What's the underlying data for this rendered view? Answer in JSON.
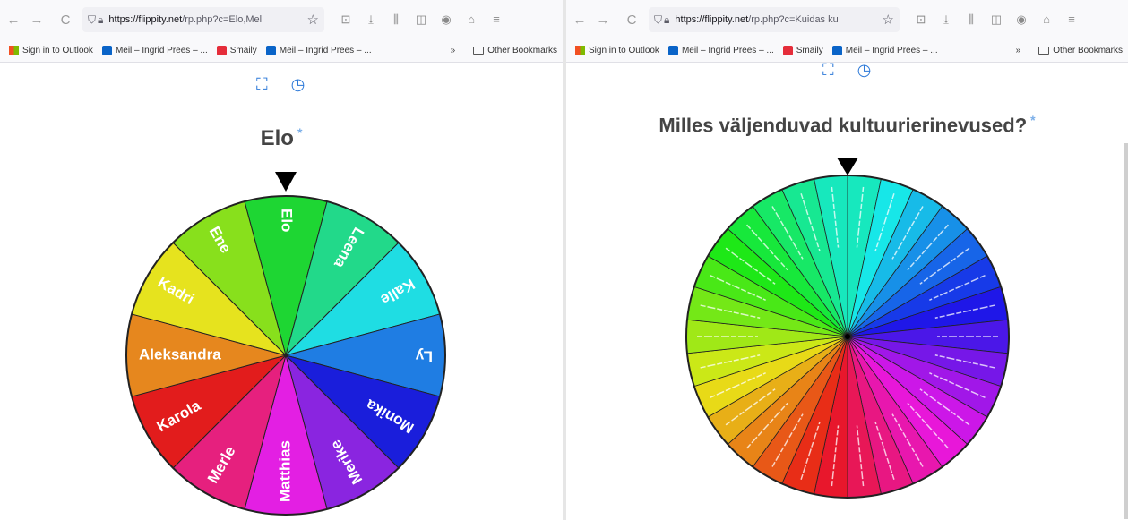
{
  "left": {
    "toolbar": {
      "url_host": "https://flippity.net",
      "url_path": "/rp.php?c=Elo,Mel"
    },
    "bookmarks": [
      {
        "label": "Sign in to Outlook",
        "icon": "microsoft-icon"
      },
      {
        "label": "Meil – Ingrid Prees – ...",
        "icon": "outlook-icon"
      },
      {
        "label": "Smaily",
        "icon": "smaily-icon"
      },
      {
        "label": "Meil – Ingrid Prees – ...",
        "icon": "outlook-icon"
      }
    ],
    "bookmarks_overflow": "»",
    "other_bookmarks": "Other Bookmarks",
    "title": "Elo",
    "title_link": "*",
    "wheel": [
      {
        "name": "Elo",
        "color": "#1ed633"
      },
      {
        "name": "Leena",
        "color": "#22d98a"
      },
      {
        "name": "Kalle",
        "color": "#1fdde3"
      },
      {
        "name": "Ly",
        "color": "#1f7de3"
      },
      {
        "name": "Monika",
        "color": "#1a1edb"
      },
      {
        "name": "Merike",
        "color": "#8a25e0"
      },
      {
        "name": "Matthias",
        "color": "#e31fe3"
      },
      {
        "name": "Merle",
        "color": "#e6207e"
      },
      {
        "name": "Karola",
        "color": "#e21c1c"
      },
      {
        "name": "Aleksandra",
        "color": "#e6871e"
      },
      {
        "name": "Kadri",
        "color": "#e6e31e"
      },
      {
        "name": "Ene",
        "color": "#88e01c"
      }
    ]
  },
  "right": {
    "toolbar": {
      "url_host": "https://flippity.net",
      "url_path": "/rp.php?c=Kuidas ku"
    },
    "bookmarks": [
      {
        "label": "Sign in to Outlook",
        "icon": "microsoft-icon"
      },
      {
        "label": "Meil – Ingrid Prees – ...",
        "icon": "outlook-icon"
      },
      {
        "label": "Smaily",
        "icon": "smaily-icon"
      },
      {
        "label": "Meil – Ingrid Prees – ...",
        "icon": "outlook-icon"
      }
    ],
    "bookmarks_overflow": "»",
    "other_bookmarks": "Other Bookmarks",
    "title": "Milles väljenduvad kultuurierinevused?",
    "title_link": "*",
    "segment_count": 30
  },
  "icons": {
    "back": "←",
    "forward": "→",
    "reload": "C",
    "shield": "⛉",
    "lock": "🔒︎",
    "star": "☆",
    "pocket": "⊡",
    "download": "⤓",
    "library": "⫼",
    "sidebar": "◫",
    "account": "◉",
    "extensions": "⌂",
    "menu": "≡",
    "fullscreen": "⛶",
    "timer": "◷"
  },
  "colors": {
    "pointer": "#000000",
    "title": "#444444",
    "link": "#7aaee8"
  }
}
